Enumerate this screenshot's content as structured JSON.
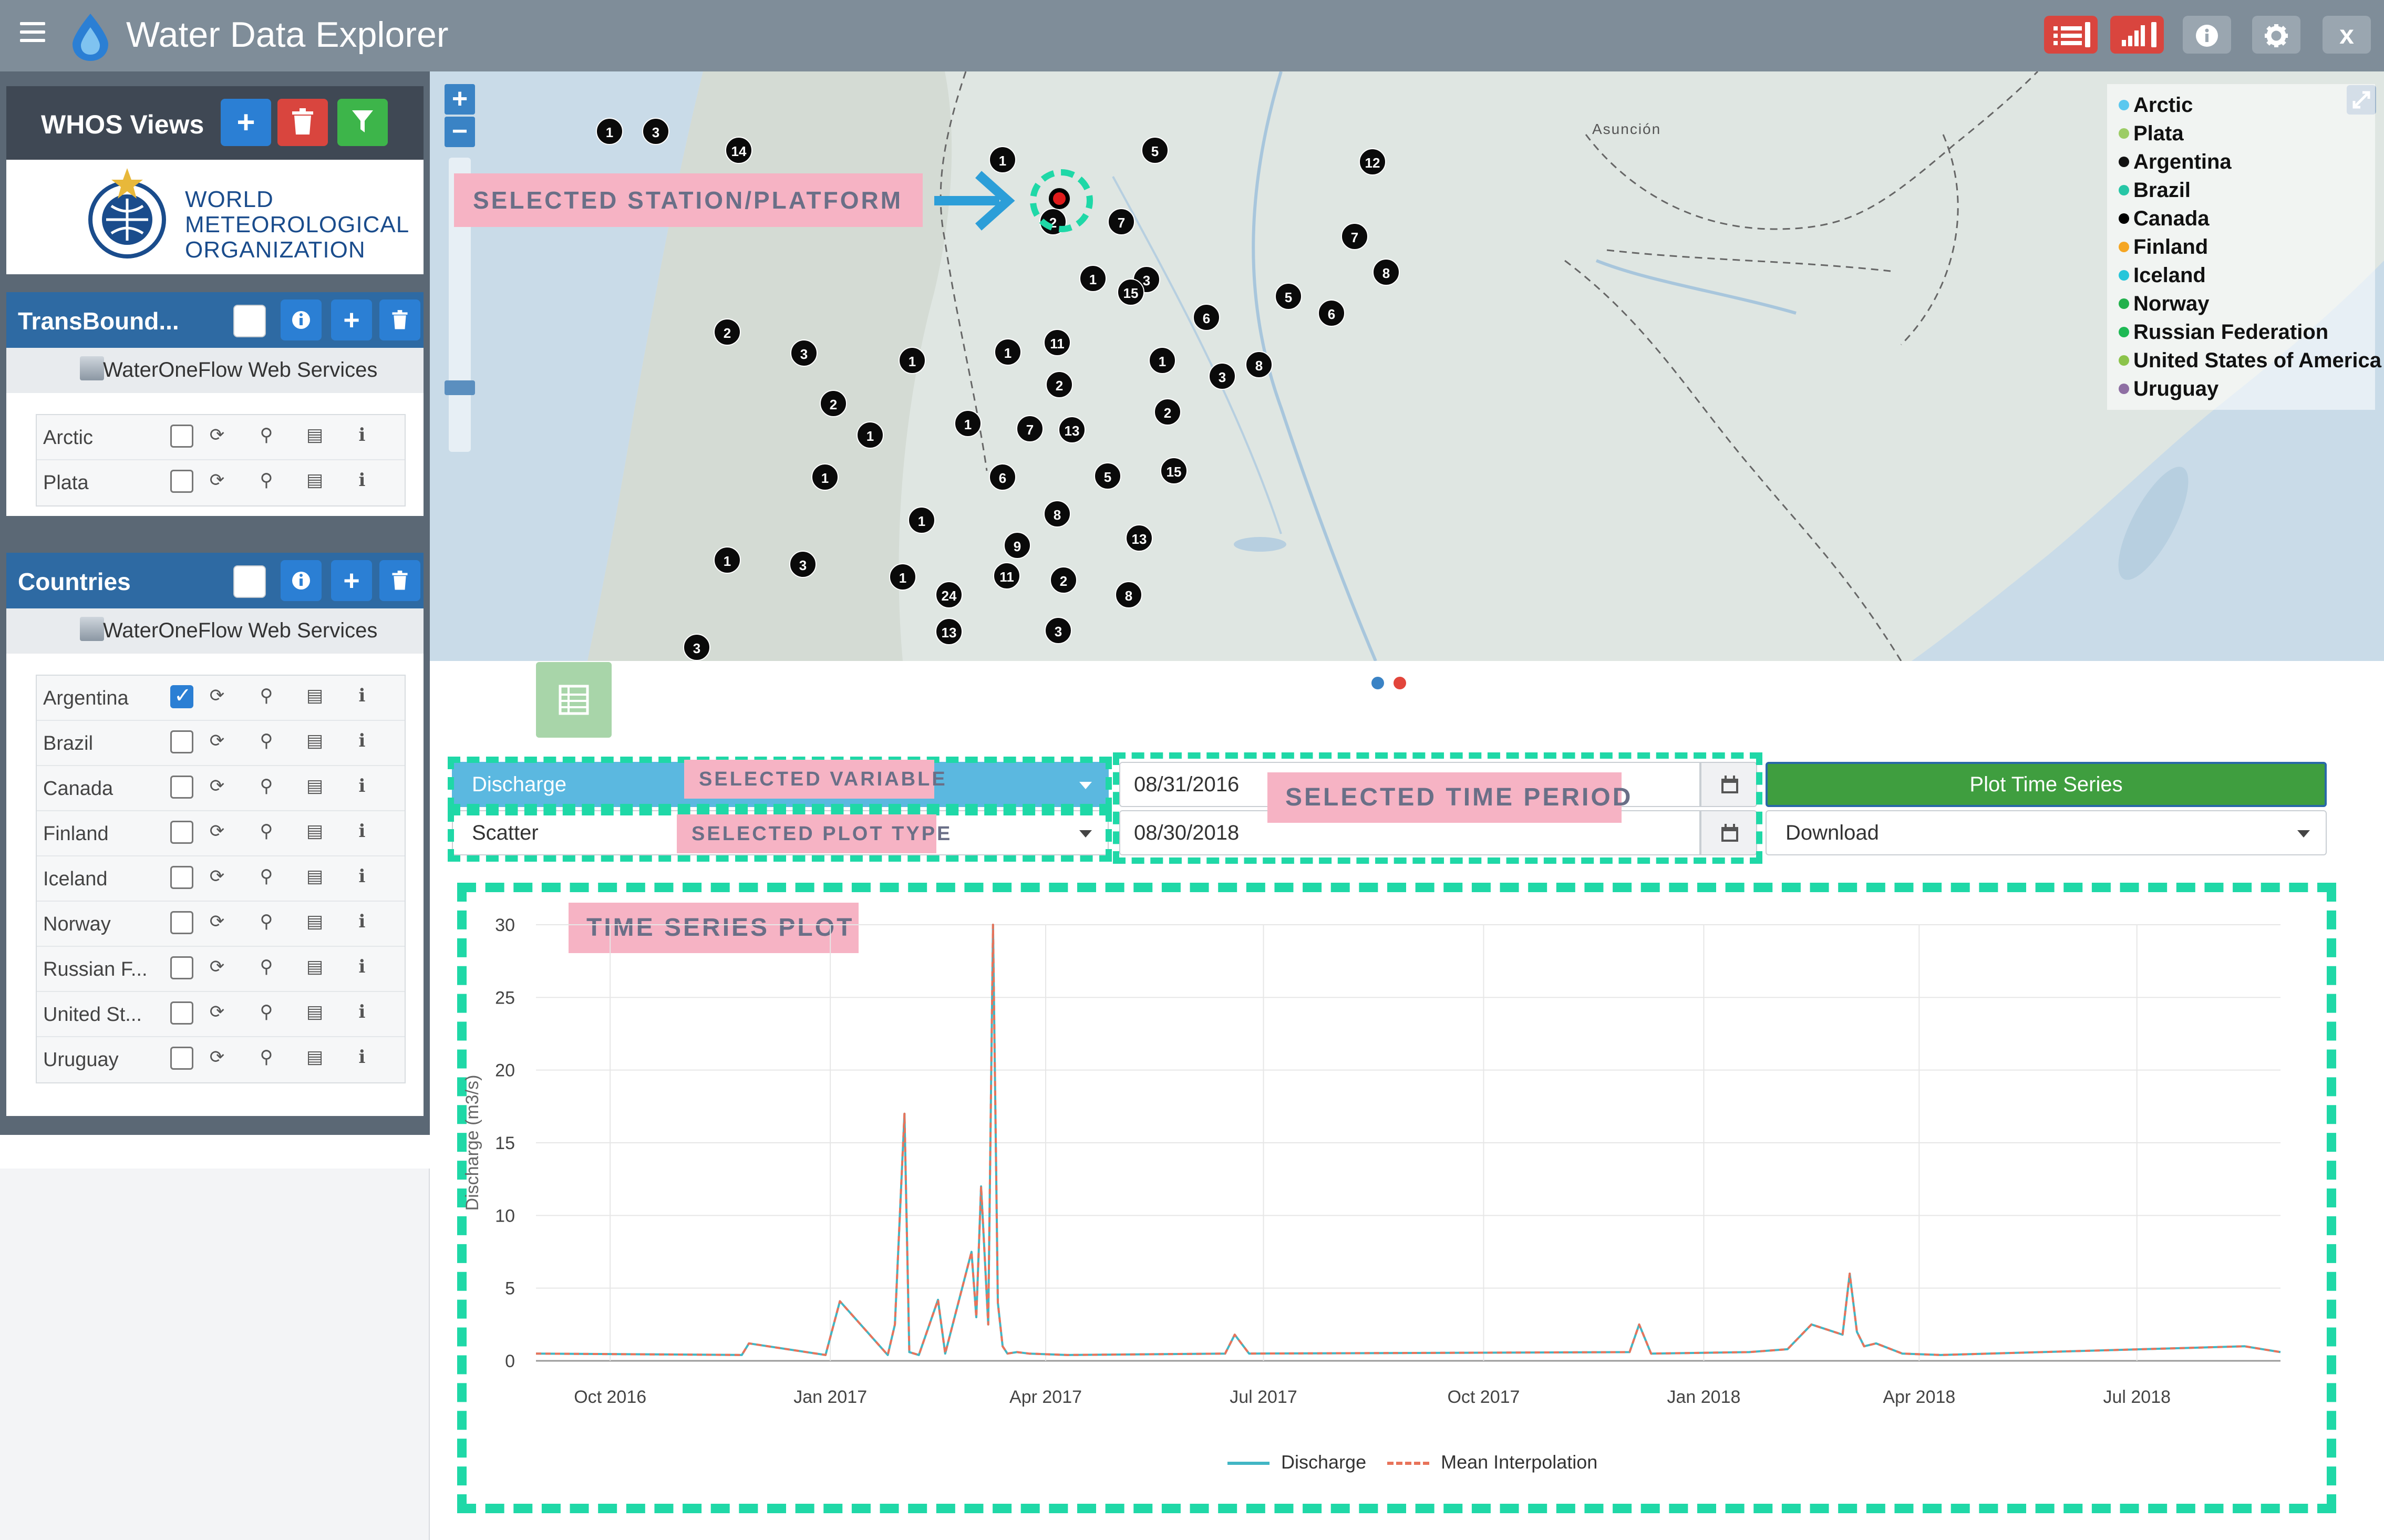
{
  "app": {
    "title": "Water Data Explorer",
    "close_label": "x"
  },
  "sidebar": {
    "whos_title": "WHOS Views",
    "wmo_lines": [
      "WORLD",
      "METEOROLOGICAL",
      "ORGANIZATION"
    ],
    "groups": [
      {
        "title": "TransBound...",
        "service_label": "WaterOneFlow Web Services",
        "services": [
          {
            "name": "Arctic",
            "checked": false
          },
          {
            "name": "Plata",
            "checked": false
          }
        ]
      },
      {
        "title": "Countries",
        "service_label": "WaterOneFlow Web Services",
        "services": [
          {
            "name": "Argentina",
            "checked": true
          },
          {
            "name": "Brazil",
            "checked": false
          },
          {
            "name": "Canada",
            "checked": false
          },
          {
            "name": "Finland",
            "checked": false
          },
          {
            "name": "Iceland",
            "checked": false
          },
          {
            "name": "Norway",
            "checked": false
          },
          {
            "name": "Russian F...",
            "checked": false
          },
          {
            "name": "United St...",
            "checked": false
          },
          {
            "name": "Uruguay",
            "checked": false
          }
        ]
      }
    ]
  },
  "map": {
    "city_label": "Asunción",
    "zoom_in": "+",
    "zoom_out": "−",
    "legend": [
      {
        "name": "Arctic",
        "color": "#5bc8ef"
      },
      {
        "name": "Plata",
        "color": "#9ccc65"
      },
      {
        "name": "Argentina",
        "color": "#111111"
      },
      {
        "name": "Brazil",
        "color": "#26c6a6"
      },
      {
        "name": "Canada",
        "color": "#000000"
      },
      {
        "name": "Finland",
        "color": "#f5a623"
      },
      {
        "name": "Iceland",
        "color": "#26c6da"
      },
      {
        "name": "Norway",
        "color": "#22b14c"
      },
      {
        "name": "Russian Federation",
        "color": "#1db954"
      },
      {
        "name": "United States of America",
        "color": "#8bc34a"
      },
      {
        "name": "Uruguay",
        "color": "#8e6fa3"
      }
    ],
    "markers": [
      "1",
      "3",
      "14",
      "1",
      "1",
      "5",
      "12",
      "2",
      "2",
      "7",
      "3",
      "1",
      "15",
      "5",
      "7",
      "8",
      "6",
      "6",
      "2",
      "3",
      "1",
      "1",
      "11",
      "1",
      "3",
      "8",
      "2",
      "2",
      "2",
      "1",
      "1",
      "7",
      "13",
      "1",
      "6",
      "5",
      "15",
      "1",
      "8",
      "13",
      "9",
      "1",
      "3",
      "1",
      "24",
      "11",
      "2",
      "8",
      "13",
      "3",
      "3"
    ]
  },
  "annotations": {
    "station": "SELECTED STATION/PLATFORM",
    "variable": "SELECTED VARIABLE",
    "plot_type": "SELECTED PLOT TYPE",
    "time_period": "SELECTED TIME PERIOD",
    "time_series": "TIME SERIES PLOT"
  },
  "controls": {
    "variable": "Discharge",
    "plot_type": "Scatter",
    "start_date": "08/31/2016",
    "end_date": "08/30/2018",
    "plot_button": "Plot Time Series",
    "download": "Download"
  },
  "chart_data": {
    "type": "line",
    "ylabel": "Discharge (m3/s)",
    "y_ticks": [
      "0",
      "5",
      "10",
      "15",
      "20",
      "25",
      "30"
    ],
    "ylim": [
      0,
      30
    ],
    "x_ticks": [
      "Oct 2016",
      "Jan 2017",
      "Apr 2017",
      "Jul 2017",
      "Oct 2017",
      "Jan 2018",
      "Apr 2018",
      "Jul 2018"
    ],
    "xlim": [
      "2016-08-31",
      "2018-08-30"
    ],
    "grid": true,
    "legend_position": "bottom",
    "series": [
      {
        "name": "Discharge",
        "color": "#41b6c4",
        "dash": "solid",
        "x": [
          "2016-08-31",
          "2016-11-25",
          "2016-11-28",
          "2016-12-30",
          "2017-01-05",
          "2017-01-25",
          "2017-01-28",
          "2017-02-01",
          "2017-02-03",
          "2017-02-07",
          "2017-02-15",
          "2017-02-18",
          "2017-03-01",
          "2017-03-03",
          "2017-03-05",
          "2017-03-08",
          "2017-03-10",
          "2017-03-12",
          "2017-03-14",
          "2017-03-16",
          "2017-03-20",
          "2017-03-25",
          "2017-04-10",
          "2017-06-15",
          "2017-06-19",
          "2017-06-25",
          "2017-12-01",
          "2017-12-05",
          "2017-12-10",
          "2018-01-20",
          "2018-02-05",
          "2018-02-15",
          "2018-02-28",
          "2018-03-03",
          "2018-03-06",
          "2018-03-09",
          "2018-03-14",
          "2018-03-25",
          "2018-04-10",
          "2018-08-15",
          "2018-08-30"
        ],
        "y": [
          0.5,
          0.4,
          1.2,
          0.4,
          4.1,
          0.4,
          2.5,
          17.0,
          0.6,
          0.4,
          4.2,
          0.5,
          7.5,
          3.0,
          12.0,
          2.5,
          30.0,
          4.0,
          1.0,
          0.5,
          0.6,
          0.5,
          0.4,
          0.5,
          1.8,
          0.5,
          0.6,
          2.5,
          0.5,
          0.6,
          0.8,
          2.5,
          1.8,
          6.0,
          2.0,
          1.0,
          1.2,
          0.5,
          0.4,
          1.0,
          0.6
        ]
      },
      {
        "name": "Mean Interpolation",
        "color": "#e8735a",
        "dash": "dashed",
        "x": [
          "2016-08-31",
          "2016-11-25",
          "2016-11-28",
          "2016-12-30",
          "2017-01-05",
          "2017-01-25",
          "2017-01-28",
          "2017-02-01",
          "2017-02-03",
          "2017-02-07",
          "2017-02-15",
          "2017-02-18",
          "2017-03-01",
          "2017-03-03",
          "2017-03-05",
          "2017-03-08",
          "2017-03-10",
          "2017-03-12",
          "2017-03-14",
          "2017-03-16",
          "2017-03-20",
          "2017-03-25",
          "2017-04-10",
          "2017-06-15",
          "2017-06-19",
          "2017-06-25",
          "2017-12-01",
          "2017-12-05",
          "2017-12-10",
          "2018-01-20",
          "2018-02-05",
          "2018-02-15",
          "2018-02-28",
          "2018-03-03",
          "2018-03-06",
          "2018-03-09",
          "2018-03-14",
          "2018-03-25",
          "2018-04-10",
          "2018-08-15",
          "2018-08-30"
        ],
        "y": [
          0.5,
          0.4,
          1.2,
          0.4,
          4.1,
          0.4,
          2.5,
          17.0,
          0.6,
          0.4,
          4.2,
          0.5,
          7.5,
          3.0,
          12.0,
          2.5,
          30.0,
          4.0,
          1.0,
          0.5,
          0.6,
          0.5,
          0.4,
          0.5,
          1.8,
          0.5,
          0.6,
          2.5,
          0.5,
          0.6,
          0.8,
          2.5,
          1.8,
          6.0,
          2.0,
          1.0,
          1.2,
          0.5,
          0.4,
          1.0,
          0.6
        ]
      }
    ]
  }
}
